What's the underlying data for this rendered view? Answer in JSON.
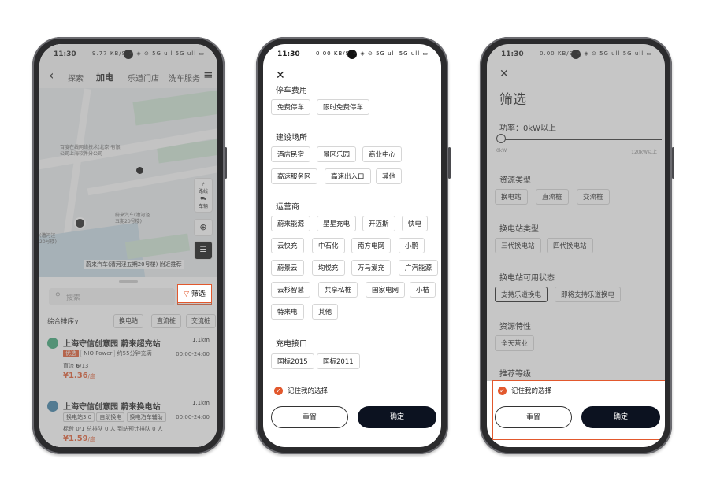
{
  "status": {
    "time": "11:30",
    "icons": "9.77 KB/S ✦ ◈ ⊙ 5G ull 5G ull ▭",
    "icons2": "0.00 KB/S ✦ ◈ ⊙ 5G ull 5G ull ▭"
  },
  "p1": {
    "back": "‹",
    "tabs": [
      "探索",
      "加电",
      "乐道门店",
      "洗车服务"
    ],
    "menu": "≡",
    "map_labels": [
      "百度在线网络技术(北京)有限\n公司上海软件分公司",
      "蔚来汽车(漕河泾\n五期20号楼)",
      "(漕河泾\n20号楼)"
    ],
    "map_buttons": [
      "路线",
      "车辆"
    ],
    "nearby": "蔚来汽车(漕河泾五期20号楼) 附近推荐",
    "search_placeholder": "搜索",
    "filter": "筛选",
    "sort": "综合排序∨",
    "chips": [
      "换电站",
      "直流桩",
      "交流桩"
    ],
    "stations": [
      {
        "name": "上海守信创意园 蔚来超充站",
        "dist": "1.1km",
        "tag1": "优选",
        "tag2": "NIO Power",
        "wait": "约55分钟充满",
        "hours": "00:00-24:00",
        "avail_label": "直流",
        "avail": "6",
        "total": "/13",
        "price": "¥1.36",
        "unit": "/度"
      },
      {
        "name": "上海守信创意园 蔚来换电站",
        "dist": "1.1km",
        "tag1": "换电站3.0",
        "tag2": "自助换电",
        "wait": "换电泊车辅助",
        "hours": "00:00-24:00",
        "queue": "标段 0/1  总排队 0 人  到站预计排队 0 人",
        "price": "¥1.59",
        "unit": "/度"
      }
    ]
  },
  "p2": {
    "sections": [
      {
        "title": "停车费用",
        "chips": [
          "免费停车",
          "限时免费停车"
        ]
      },
      {
        "title": "建设场所",
        "chips": [
          "酒店民宿",
          "景区乐园",
          "商业中心",
          "高速服务区",
          "高速出入口",
          "其他"
        ]
      },
      {
        "title": "运营商",
        "chips": [
          "蔚来能源",
          "星星充电",
          "开迈斯",
          "快电",
          "云快充",
          "中石化",
          "南方电网",
          "小鹏",
          "蔚景云",
          "均悦充",
          "万马爱充",
          "广汽能源",
          "云杉智慧",
          "共享私桩",
          "国家电网",
          "小桔",
          "特来电",
          "其他"
        ]
      },
      {
        "title": "充电接口",
        "chips": [
          "国标2015",
          "国标2011"
        ]
      }
    ],
    "remember": "记住我的选择",
    "reset": "重置",
    "ok": "确定"
  },
  "p3": {
    "title": "筛选",
    "power_label": "功率：",
    "power_value": "0kW以上",
    "slider_min": "0kW",
    "slider_max": "120kW以上",
    "slider_value": 0,
    "sections": [
      {
        "title": "资源类型",
        "chips": [
          "换电站",
          "直流桩",
          "交流桩"
        ]
      },
      {
        "title": "换电站类型",
        "chips": [
          "三代换电站",
          "四代换电站"
        ]
      },
      {
        "title": "换电站可用状态",
        "chips": [
          "支持乐道换电",
          "即将支持乐道换电"
        ]
      },
      {
        "title": "资源特性",
        "chips": [
          "全天营业"
        ]
      },
      {
        "title": "推荐等级",
        "chips": []
      }
    ],
    "remember": "记住我的选择",
    "reset": "重置",
    "ok": "确定"
  },
  "colors": {
    "accent": "#e2582d",
    "dark_button": "#0c1220"
  }
}
